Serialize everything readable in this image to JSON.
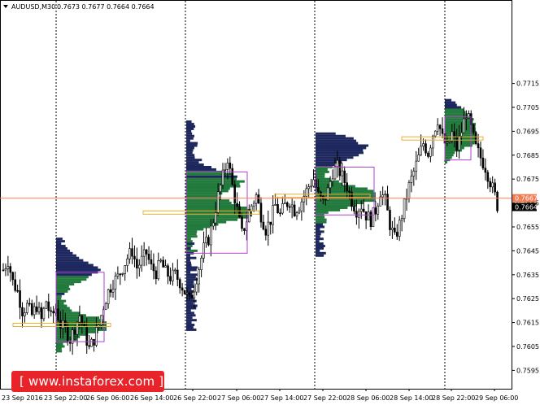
{
  "header": {
    "symbol_text": "AUDUSD,M30",
    "ohlc_text": "0.7673 0.7677 0.7664 0.7664"
  },
  "watermark": {
    "text": "[ www.instaforex.com ]"
  },
  "colors": {
    "background": "#ffffff",
    "candle": "#000000",
    "grid_session": "#000000",
    "price_line": "#ff7f50",
    "profile_dark": "#0b1650",
    "profile_green": "#0f6f2c",
    "value_area_box": "#b040d0",
    "poc_box": "#e8b030",
    "bid_label": "#f07b50",
    "last_label": "#000000"
  },
  "chart_data": {
    "type": "candlestick",
    "symbol": "AUDUSD",
    "timeframe": "M30",
    "ylim": [
      0.7591,
      0.772
    ],
    "y_ticks": [
      0.7595,
      0.7605,
      0.7615,
      0.7625,
      0.7635,
      0.7645,
      0.7655,
      0.7665,
      0.7675,
      0.7685,
      0.7695,
      0.7705,
      0.7715
    ],
    "x_tick_labels": [
      "23 Sep 2016",
      "23 Sep 22:00",
      "26 Sep 06:00",
      "26 Sep 14:00",
      "26 Sep 22:00",
      "27 Sep 06:00",
      "27 Sep 14:00",
      "27 Sep 22:00",
      "28 Sep 06:00",
      "28 Sep 14:00",
      "28 Sep 22:00",
      "29 Sep 06:00"
    ],
    "session_separators": [
      "23 Sep 22:00",
      "26 Sep 22:00",
      "27 Sep 22:00",
      "28 Sep 22:00"
    ],
    "bid_price_label": "0.7667",
    "last_price_label": "0.7664",
    "bid_price": 0.7667,
    "last_price": 0.7664,
    "close_anchors": [
      [
        0,
        0.7637
      ],
      [
        2,
        0.7641
      ],
      [
        4,
        0.7632
      ],
      [
        6,
        0.7628
      ],
      [
        8,
        0.762
      ],
      [
        10,
        0.7622
      ],
      [
        12,
        0.7618
      ],
      [
        14,
        0.7622
      ],
      [
        16,
        0.7616
      ],
      [
        18,
        0.7624
      ],
      [
        20,
        0.7617
      ],
      [
        22,
        0.7621
      ],
      [
        24,
        0.7614
      ],
      [
        26,
        0.7612
      ],
      [
        28,
        0.7608
      ],
      [
        30,
        0.7613
      ],
      [
        32,
        0.7618
      ],
      [
        34,
        0.7611
      ],
      [
        36,
        0.7604
      ],
      [
        38,
        0.7608
      ],
      [
        40,
        0.7614
      ],
      [
        42,
        0.7622
      ],
      [
        44,
        0.7628
      ],
      [
        46,
        0.7632
      ],
      [
        48,
        0.7634
      ],
      [
        50,
        0.7638
      ],
      [
        52,
        0.7642
      ],
      [
        54,
        0.7645
      ],
      [
        56,
        0.7638
      ],
      [
        58,
        0.7641
      ],
      [
        60,
        0.7644
      ],
      [
        62,
        0.7638
      ],
      [
        64,
        0.7636
      ],
      [
        66,
        0.764
      ],
      [
        68,
        0.7636
      ],
      [
        70,
        0.7634
      ],
      [
        72,
        0.7635
      ],
      [
        74,
        0.7632
      ],
      [
        76,
        0.7628
      ],
      [
        78,
        0.7624
      ],
      [
        80,
        0.763
      ],
      [
        82,
        0.7638
      ],
      [
        84,
        0.7646
      ],
      [
        86,
        0.765
      ],
      [
        88,
        0.7658
      ],
      [
        90,
        0.7668
      ],
      [
        92,
        0.7676
      ],
      [
        94,
        0.7684
      ],
      [
        96,
        0.7672
      ],
      [
        98,
        0.7662
      ],
      [
        100,
        0.7652
      ],
      [
        102,
        0.7658
      ],
      [
        104,
        0.7664
      ],
      [
        106,
        0.7668
      ],
      [
        108,
        0.766
      ],
      [
        110,
        0.7654
      ],
      [
        112,
        0.7658
      ],
      [
        114,
        0.7664
      ],
      [
        116,
        0.766
      ],
      [
        118,
        0.7664
      ],
      [
        120,
        0.7666
      ],
      [
        122,
        0.7662
      ],
      [
        124,
        0.7664
      ],
      [
        126,
        0.7668
      ],
      [
        128,
        0.7672
      ],
      [
        130,
        0.7675
      ],
      [
        132,
        0.7668
      ],
      [
        134,
        0.7665
      ],
      [
        136,
        0.767
      ],
      [
        138,
        0.7678
      ],
      [
        140,
        0.768
      ],
      [
        142,
        0.7676
      ],
      [
        144,
        0.7672
      ],
      [
        146,
        0.7666
      ],
      [
        148,
        0.7662
      ],
      [
        150,
        0.7664
      ],
      [
        152,
        0.766
      ],
      [
        154,
        0.7658
      ],
      [
        156,
        0.7662
      ],
      [
        158,
        0.767
      ],
      [
        160,
        0.7666
      ],
      [
        162,
        0.7656
      ],
      [
        164,
        0.765
      ],
      [
        166,
        0.7656
      ],
      [
        168,
        0.7664
      ],
      [
        170,
        0.7672
      ],
      [
        172,
        0.7678
      ],
      [
        174,
        0.7684
      ],
      [
        176,
        0.769
      ],
      [
        178,
        0.7686
      ],
      [
        180,
        0.7694
      ],
      [
        182,
        0.77
      ],
      [
        184,
        0.7692
      ],
      [
        186,
        0.7688
      ],
      [
        188,
        0.7694
      ],
      [
        190,
        0.7688
      ],
      [
        192,
        0.7695
      ],
      [
        194,
        0.7703
      ],
      [
        196,
        0.7696
      ],
      [
        198,
        0.7688
      ],
      [
        200,
        0.7684
      ],
      [
        202,
        0.768
      ],
      [
        204,
        0.7674
      ],
      [
        206,
        0.7668
      ],
      [
        207,
        0.7664
      ]
    ],
    "sessions": [
      {
        "profile_top": 0.765,
        "profile_bottom": 0.7603,
        "value_area_high": 0.7636,
        "value_area_low": 0.7607,
        "poc": 0.7614,
        "peak_a": 0.7637,
        "peak_b": 0.7614
      },
      {
        "profile_top": 0.7699,
        "profile_bottom": 0.7612,
        "value_area_high": 0.7678,
        "value_area_low": 0.7644,
        "poc": 0.7661,
        "peak_a": 0.7674,
        "peak_b": 0.7661
      },
      {
        "profile_top": 0.7694,
        "profile_bottom": 0.7643,
        "value_area_high": 0.768,
        "value_area_low": 0.766,
        "poc": 0.7668,
        "peak_a": 0.7688,
        "peak_b": 0.7668
      },
      {
        "profile_top": 0.7708,
        "profile_bottom": 0.7682,
        "value_area_high": 0.7701,
        "value_area_low": 0.7683,
        "poc": 0.7692,
        "peak_a": 0.77,
        "peak_b": 0.7692
      }
    ]
  }
}
